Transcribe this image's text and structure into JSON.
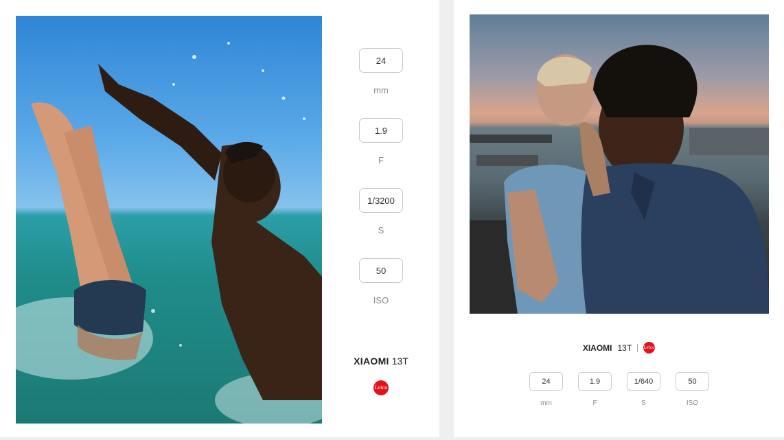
{
  "left_card": {
    "specs": [
      {
        "value": "24",
        "unit": "mm"
      },
      {
        "value": "1.9",
        "unit": "F"
      },
      {
        "value": "1/3200",
        "unit": "S"
      },
      {
        "value": "50",
        "unit": "ISO"
      }
    ],
    "brand": "XIAOMI",
    "model": "13T",
    "leica_logo_text": "Leica"
  },
  "right_card": {
    "brand": "XIAOMI",
    "model": "13T",
    "leica_logo_text": "Leica",
    "specs": [
      {
        "value": "24",
        "unit": "mm"
      },
      {
        "value": "1.9",
        "unit": "F"
      },
      {
        "value": "1/640",
        "unit": "S"
      },
      {
        "value": "50",
        "unit": "ISO"
      }
    ]
  }
}
